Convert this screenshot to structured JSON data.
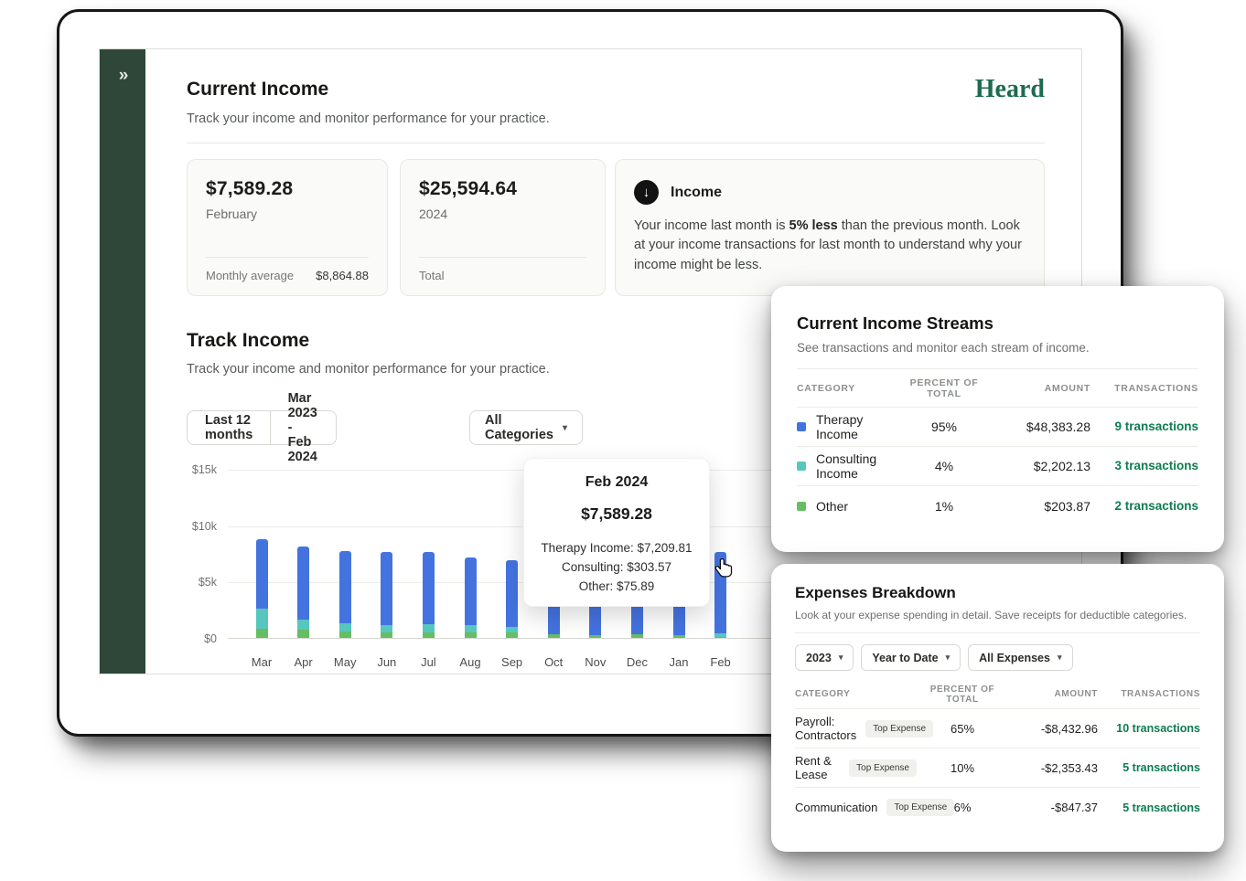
{
  "brand": {
    "logo_text": "Heard",
    "logo_color": "#1C6B50"
  },
  "colors": {
    "sidebar_green": "#2E4739",
    "link_green": "#0E7C52",
    "bar_blue": "#4473E0",
    "bar_teal": "#57C6BE",
    "bar_green": "#66BE63"
  },
  "glyphs": {
    "double_chevron_right": "»",
    "chevron_down": "▾",
    "arrow_down": "↓"
  },
  "current_income": {
    "title": "Current Income",
    "subtitle": "Track your income and monitor performance for your practice.",
    "month_card": {
      "value": "$7,589.28",
      "period": "February",
      "footer_label": "Monthly average",
      "footer_value": "$8,864.88"
    },
    "year_card": {
      "value": "$25,594.64",
      "period": "2024",
      "footer_label": "Total"
    },
    "insight_card": {
      "icon": "arrow-down-circle",
      "title": "Income",
      "text_before": "Your income last month is ",
      "text_bold": "5% less",
      "text_after": " than the previous month. Look at your income transactions for last month to understand why your income might be less."
    }
  },
  "track_income": {
    "title": "Track Income",
    "subtitle": "Track your income and monitor performance for your practice.",
    "filters": {
      "range": "Last 12 months",
      "dates": "Mar 2023 - Feb 2024",
      "category": "All Categories"
    },
    "tooltip": {
      "title": "Feb 2024",
      "total": "$7,589.28",
      "lines": [
        "Therapy Income: $7,209.81",
        "Consulting: $303.57",
        "Other: $75.89"
      ]
    }
  },
  "chart_data": {
    "type": "bar",
    "stacked": true,
    "title": "Track Income",
    "categories": [
      "Mar",
      "Apr",
      "May",
      "Jun",
      "Jul",
      "Aug",
      "Sep",
      "Oct",
      "Nov",
      "Dec",
      "Jan",
      "Feb"
    ],
    "series": [
      {
        "name": "Other",
        "color": "#66BE63",
        "values": [
          800,
          700,
          600,
          500,
          500,
          500,
          450,
          300,
          250,
          300,
          250,
          75.89
        ]
      },
      {
        "name": "Consulting",
        "color": "#57C6BE",
        "values": [
          1800,
          900,
          700,
          600,
          750,
          650,
          500,
          0,
          0,
          0,
          0,
          303.57
        ]
      },
      {
        "name": "Therapy Income",
        "color": "#4473E0",
        "values": [
          6200,
          6500,
          6400,
          6500,
          6350,
          5950,
          5950,
          3000,
          2750,
          2900,
          2750,
          7209.81
        ]
      }
    ],
    "yticks": [
      "$0",
      "$5k",
      "$10k",
      "$15k"
    ],
    "ylim": [
      0,
      15000
    ],
    "grid": true,
    "legend": false,
    "xlabel": "",
    "ylabel": ""
  },
  "income_streams": {
    "title": "Current Income Streams",
    "subtitle": "See transactions and monitor each stream of income.",
    "columns": {
      "category": "CATEGORY",
      "percent": "PERCENT OF TOTAL",
      "amount": "AMOUNT",
      "transactions": "TRANSACTIONS"
    },
    "rows": [
      {
        "color": "#4473E0",
        "category": "Therapy Income",
        "percent": "95%",
        "amount": "$48,383.28",
        "transactions": "9 transactions"
      },
      {
        "color": "#57C6BE",
        "category": "Consulting Income",
        "percent": "4%",
        "amount": "$2,202.13",
        "transactions": "3 transactions"
      },
      {
        "color": "#66BE63",
        "category": "Other",
        "percent": "1%",
        "amount": "$203.87",
        "transactions": "2 transactions"
      }
    ]
  },
  "expenses": {
    "title": "Expenses Breakdown",
    "subtitle": "Look at your expense spending in detail. Save receipts for deductible categories.",
    "filters": [
      "2023",
      "Year to Date",
      "All Expenses"
    ],
    "columns": {
      "category": "CATEGORY",
      "percent": "PERCENT OF TOTAL",
      "amount": "AMOUNT",
      "transactions": "TRANSACTIONS"
    },
    "rows": [
      {
        "category": "Payroll: Contractors",
        "badge": "Top Expense",
        "percent": "65%",
        "amount": "-$8,432.96",
        "transactions": "10 transactions"
      },
      {
        "category": "Rent & Lease",
        "badge": "Top Expense",
        "percent": "10%",
        "amount": "-$2,353.43",
        "transactions": "5 transactions"
      },
      {
        "category": "Communication",
        "badge": "Top Expense",
        "percent": "6%",
        "amount": "-$847.37",
        "transactions": "5 transactions"
      }
    ]
  }
}
